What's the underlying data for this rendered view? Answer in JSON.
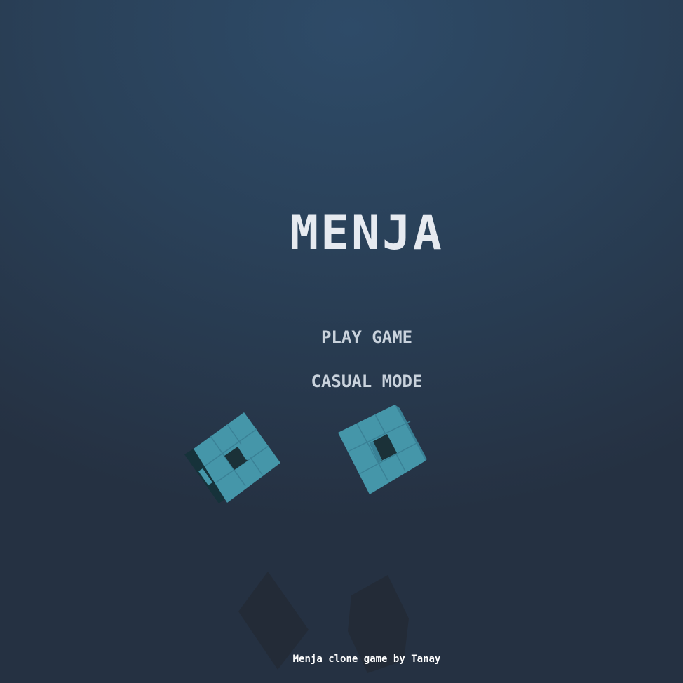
{
  "game": {
    "title": "MENJA",
    "menu": {
      "play_label": "PLAY GAME",
      "casual_label": "CASUAL MODE"
    },
    "footer": {
      "prefix": "Menja clone game by",
      "author_link": "Tanay"
    },
    "colors": {
      "background_top": "#2e4b68",
      "background_bottom": "#253142",
      "cube_face": "#4596a9",
      "cube_dark": "#16323a",
      "shadow": "#232b36"
    },
    "objects": [
      "cube-left",
      "cube-right",
      "shadow-left",
      "shadow-right"
    ]
  }
}
